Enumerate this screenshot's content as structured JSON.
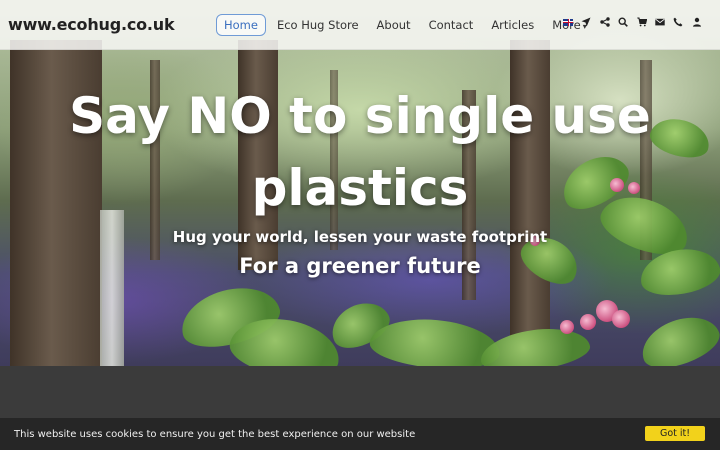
{
  "site": {
    "brand": "www.ecohug.co.uk"
  },
  "nav": {
    "items": [
      {
        "label": "Home",
        "active": true
      },
      {
        "label": "Eco Hug Store",
        "active": false
      },
      {
        "label": "About",
        "active": false
      },
      {
        "label": "Contact",
        "active": false
      },
      {
        "label": "Articles",
        "active": false
      },
      {
        "label": "More",
        "active": false
      }
    ],
    "more_caret": "▾",
    "icons": [
      "uk-flag-icon",
      "location-arrow-icon",
      "share-icon",
      "search-icon",
      "cart-icon",
      "envelope-icon",
      "phone-icon",
      "user-icon"
    ]
  },
  "hero": {
    "title_line1": "Say NO to single use",
    "title_line2": "plastics",
    "subtitle": "Hug your world, lessen your waste footprint",
    "tagline": "For a greener future"
  },
  "cookie": {
    "message": "This website uses cookies to ensure you get the best experience on our website",
    "button_label": "Got it!"
  },
  "colors": {
    "accent": "#3a6fbf",
    "cookie_button": "#f2d21b",
    "cookie_bar": "#262626",
    "dark_band": "#3b3b3b"
  }
}
